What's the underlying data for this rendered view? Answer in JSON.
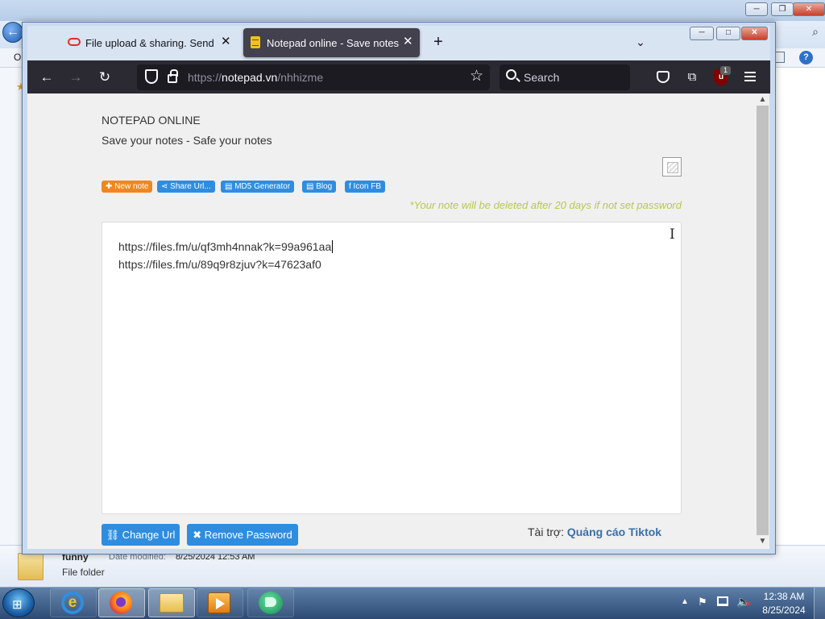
{
  "background_window": {
    "menu_fragment": "O",
    "help_icon": "?",
    "folder": {
      "name": "funny",
      "date_label": "Date modified:",
      "date_value": "8/25/2024 12:53 AM",
      "type": "File folder"
    }
  },
  "browser": {
    "tabs": [
      {
        "label": "File upload & sharing. Send large files",
        "favicon": "filesfm-icon",
        "active": false
      },
      {
        "label": "Notepad online - Save notes online",
        "favicon": "notepad-icon",
        "active": true
      }
    ],
    "new_tab_glyph": "+",
    "tab_list_glyph": "⌄",
    "address": {
      "scheme": "https://",
      "domain": "notepad.vn",
      "path": "/nhhizme"
    },
    "search_placeholder": "Search",
    "ublock_count": "1",
    "window_buttons": {
      "minimize": "─",
      "maximize": "□",
      "close": "✕"
    }
  },
  "page": {
    "site_title": "NOTEPAD ONLINE",
    "tagline": "Save your notes - Safe your notes",
    "chips": [
      {
        "label": "✚ New note",
        "color": "#f0871e"
      },
      {
        "label": "⋖ Share Url...",
        "color": "#2f8de0"
      },
      {
        "label": "▤ MD5 Generator",
        "color": "#2f8de0"
      },
      {
        "label": "▤ Blog",
        "color": "#2f8de0"
      },
      {
        "label": "f Icon FB",
        "color": "#2f8de0"
      }
    ],
    "notice": "*Your note will be deleted after 20 days if not set password",
    "note_lines": [
      "https://files.fm/u/qf3mh4nnak?k=99a961aa",
      "https://files.fm/u/89q9r8zjuv?k=47623af0"
    ],
    "buttons": {
      "change_url": "⛓ Change Url",
      "remove_password": "✖ Remove Password"
    },
    "sponsor_label": "Tài trợ:",
    "sponsor_link": "Quảng cáo Tiktok"
  },
  "taskbar": {
    "time": "12:38 AM",
    "date": "8/25/2024"
  },
  "colors": {
    "accent_blue": "#2f8de0",
    "new_note_orange": "#f0871e",
    "notice_text": "#b8c94a",
    "firefox_toolbar": "#2b2a33"
  }
}
